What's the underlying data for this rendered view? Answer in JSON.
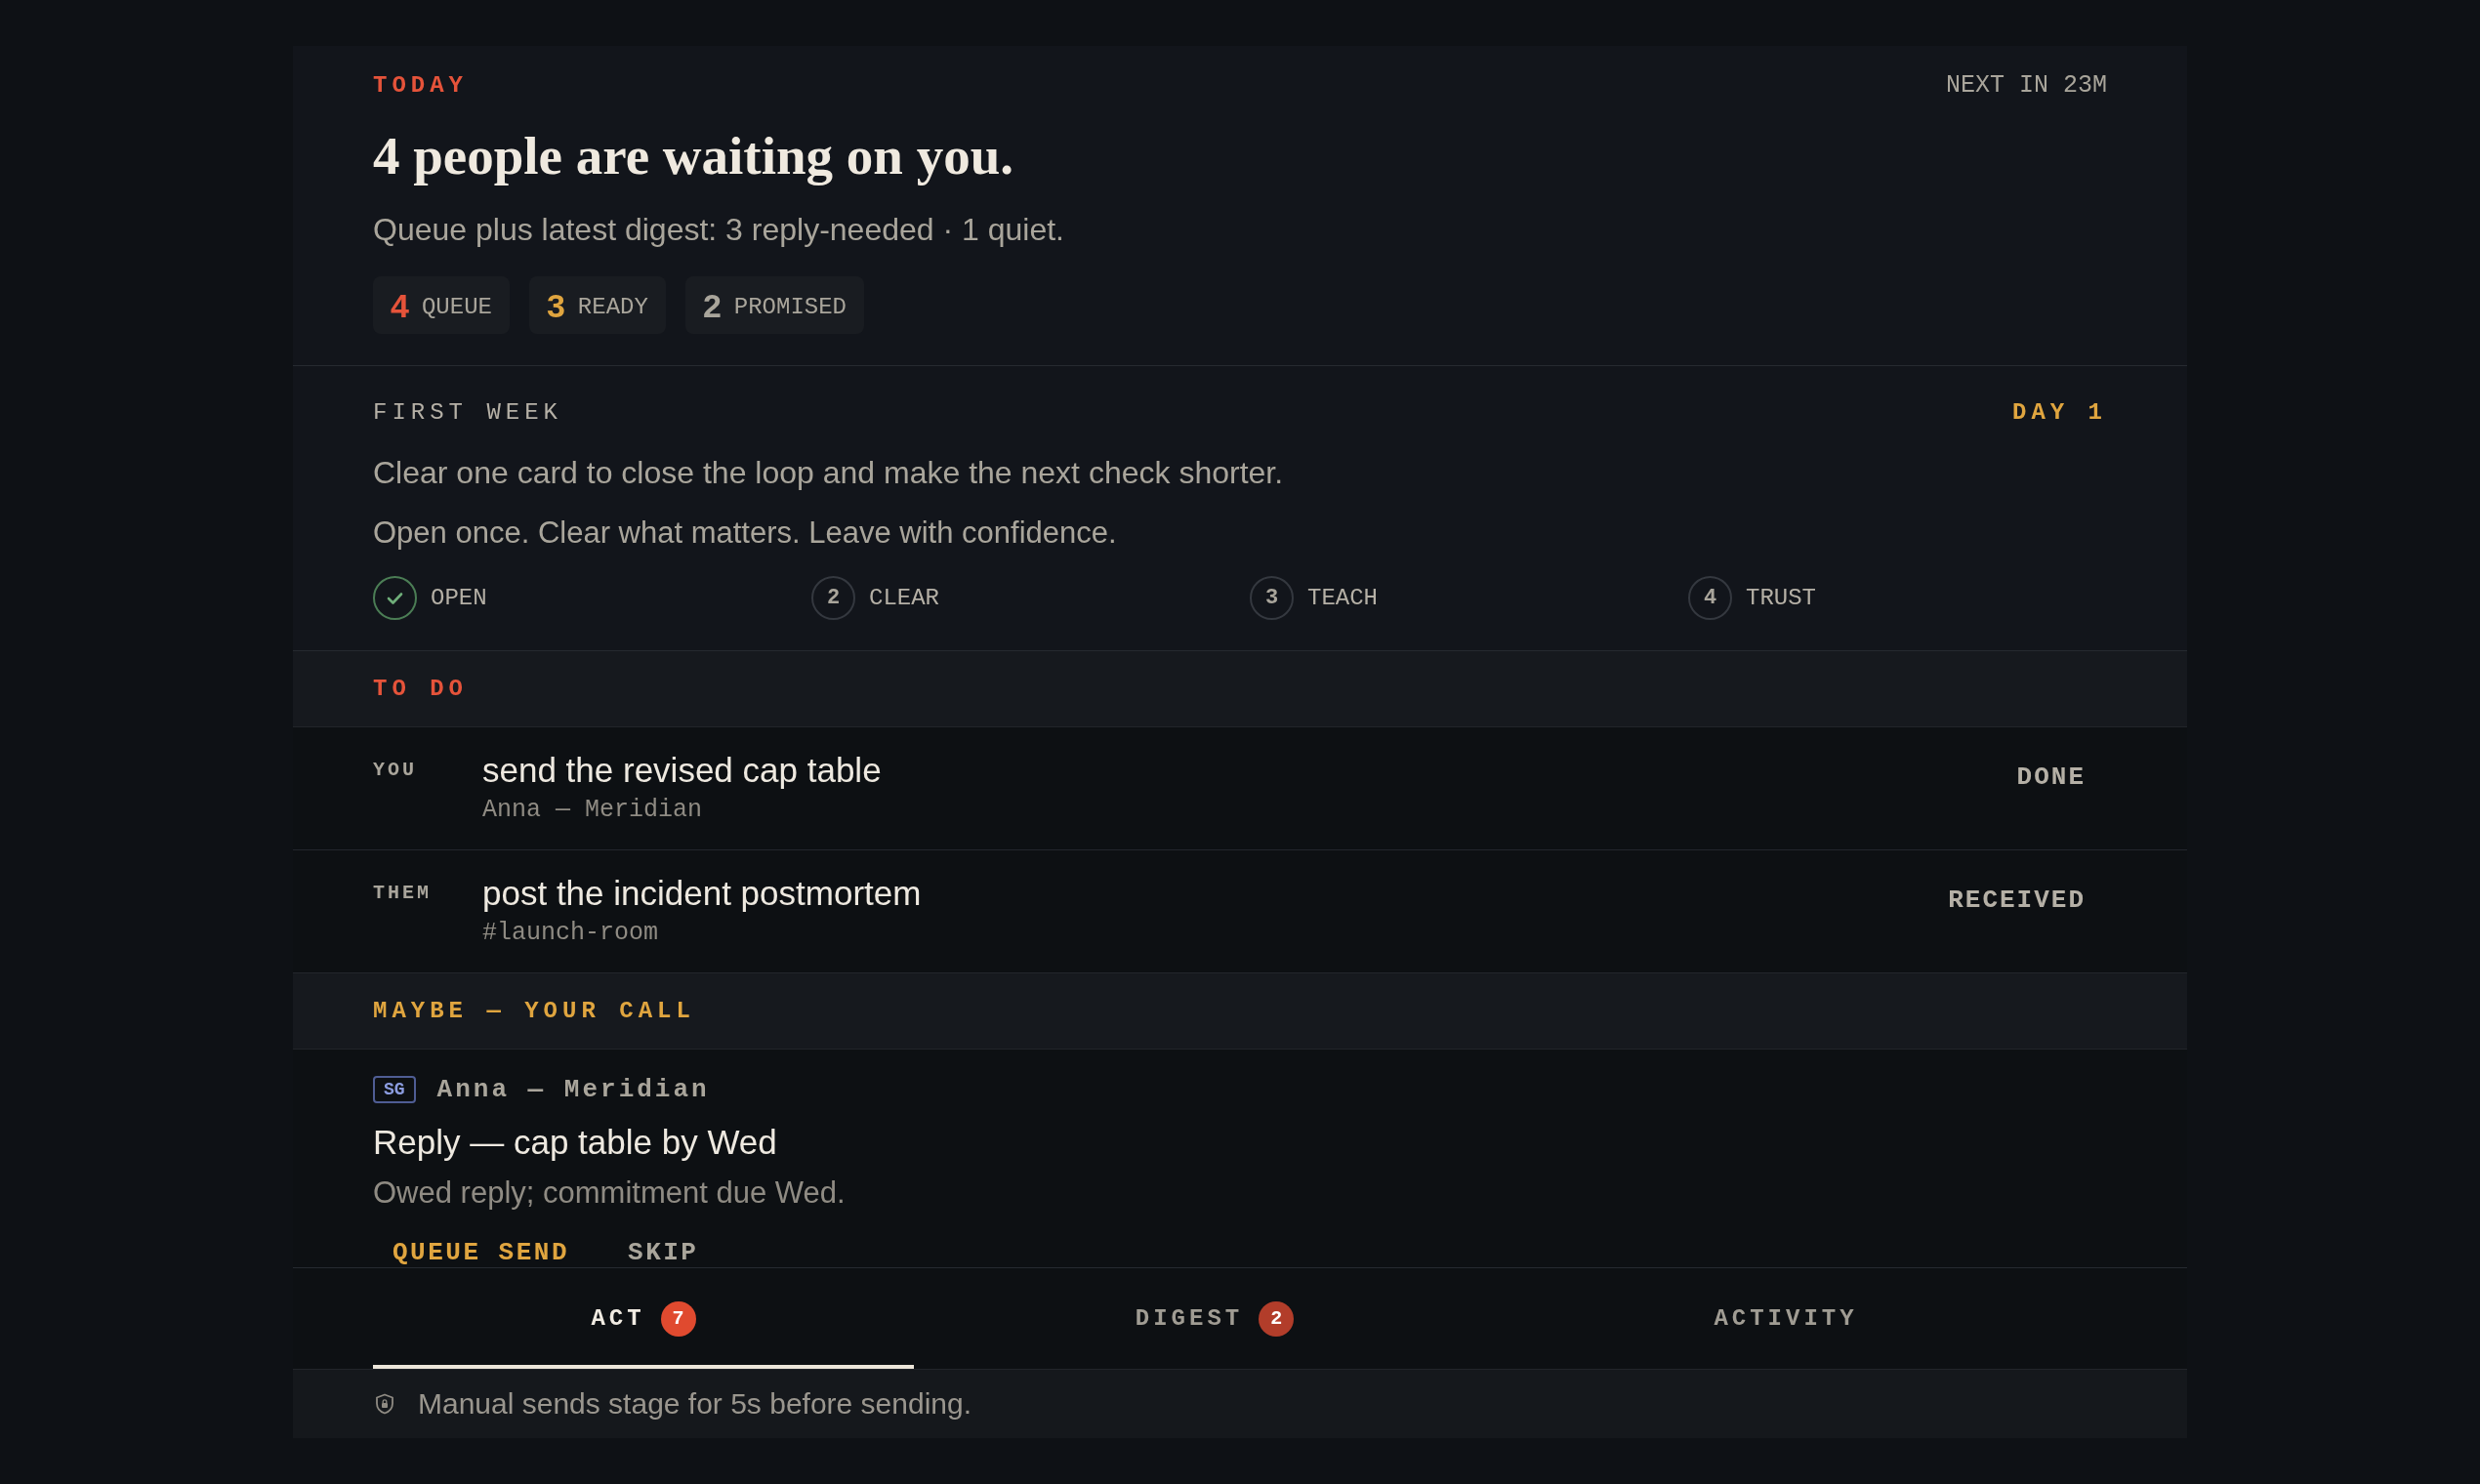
{
  "today": {
    "eyebrow": "TODAY",
    "next": "NEXT IN 23M",
    "title": "4 people are waiting on you.",
    "summary": "Queue plus latest digest: 3 reply-needed · 1 quiet.",
    "stats": [
      {
        "value": "4",
        "label": "QUEUE",
        "color": "#e5533a"
      },
      {
        "value": "3",
        "label": "READY",
        "color": "#e0a53f"
      },
      {
        "value": "2",
        "label": "PROMISED",
        "color": "#a9a59b"
      }
    ]
  },
  "first_week": {
    "heading": "FIRST WEEK",
    "day": "DAY 1",
    "lines": [
      "Clear one card to close the loop and make the next check shorter.",
      "Open once. Clear what matters. Leave with confidence."
    ],
    "steps": [
      {
        "label": "OPEN",
        "done": true
      },
      {
        "number": "2",
        "label": "CLEAR",
        "done": false
      },
      {
        "number": "3",
        "label": "TEACH",
        "done": false
      },
      {
        "number": "4",
        "label": "TRUST",
        "done": false
      }
    ]
  },
  "todo": {
    "heading": "TO DO",
    "items": [
      {
        "owner": "YOU",
        "title": "send the revised cap table",
        "source": "Anna — Meridian",
        "action": "DONE"
      },
      {
        "owner": "THEM",
        "title": "post the incident postmortem",
        "source": "#launch-room",
        "action": "RECEIVED"
      }
    ]
  },
  "maybe": {
    "heading": "MAYBE — YOUR CALL",
    "card": {
      "tag": "SG",
      "source": "Anna — Meridian",
      "title": "Reply — cap table by Wed",
      "reason": "Owed reply; commitment due Wed.",
      "actions": [
        {
          "label": "QUEUE SEND",
          "kind": "primary"
        },
        {
          "label": "SKIP",
          "kind": "secondary"
        }
      ]
    }
  },
  "tabs": [
    {
      "label": "ACT",
      "count": "7",
      "selected": true
    },
    {
      "label": "DIGEST",
      "count": "2",
      "selected": false
    },
    {
      "label": "ACTIVITY",
      "selected": false
    }
  ],
  "footer": {
    "text": "Manual sends stage for 5s before sending."
  }
}
